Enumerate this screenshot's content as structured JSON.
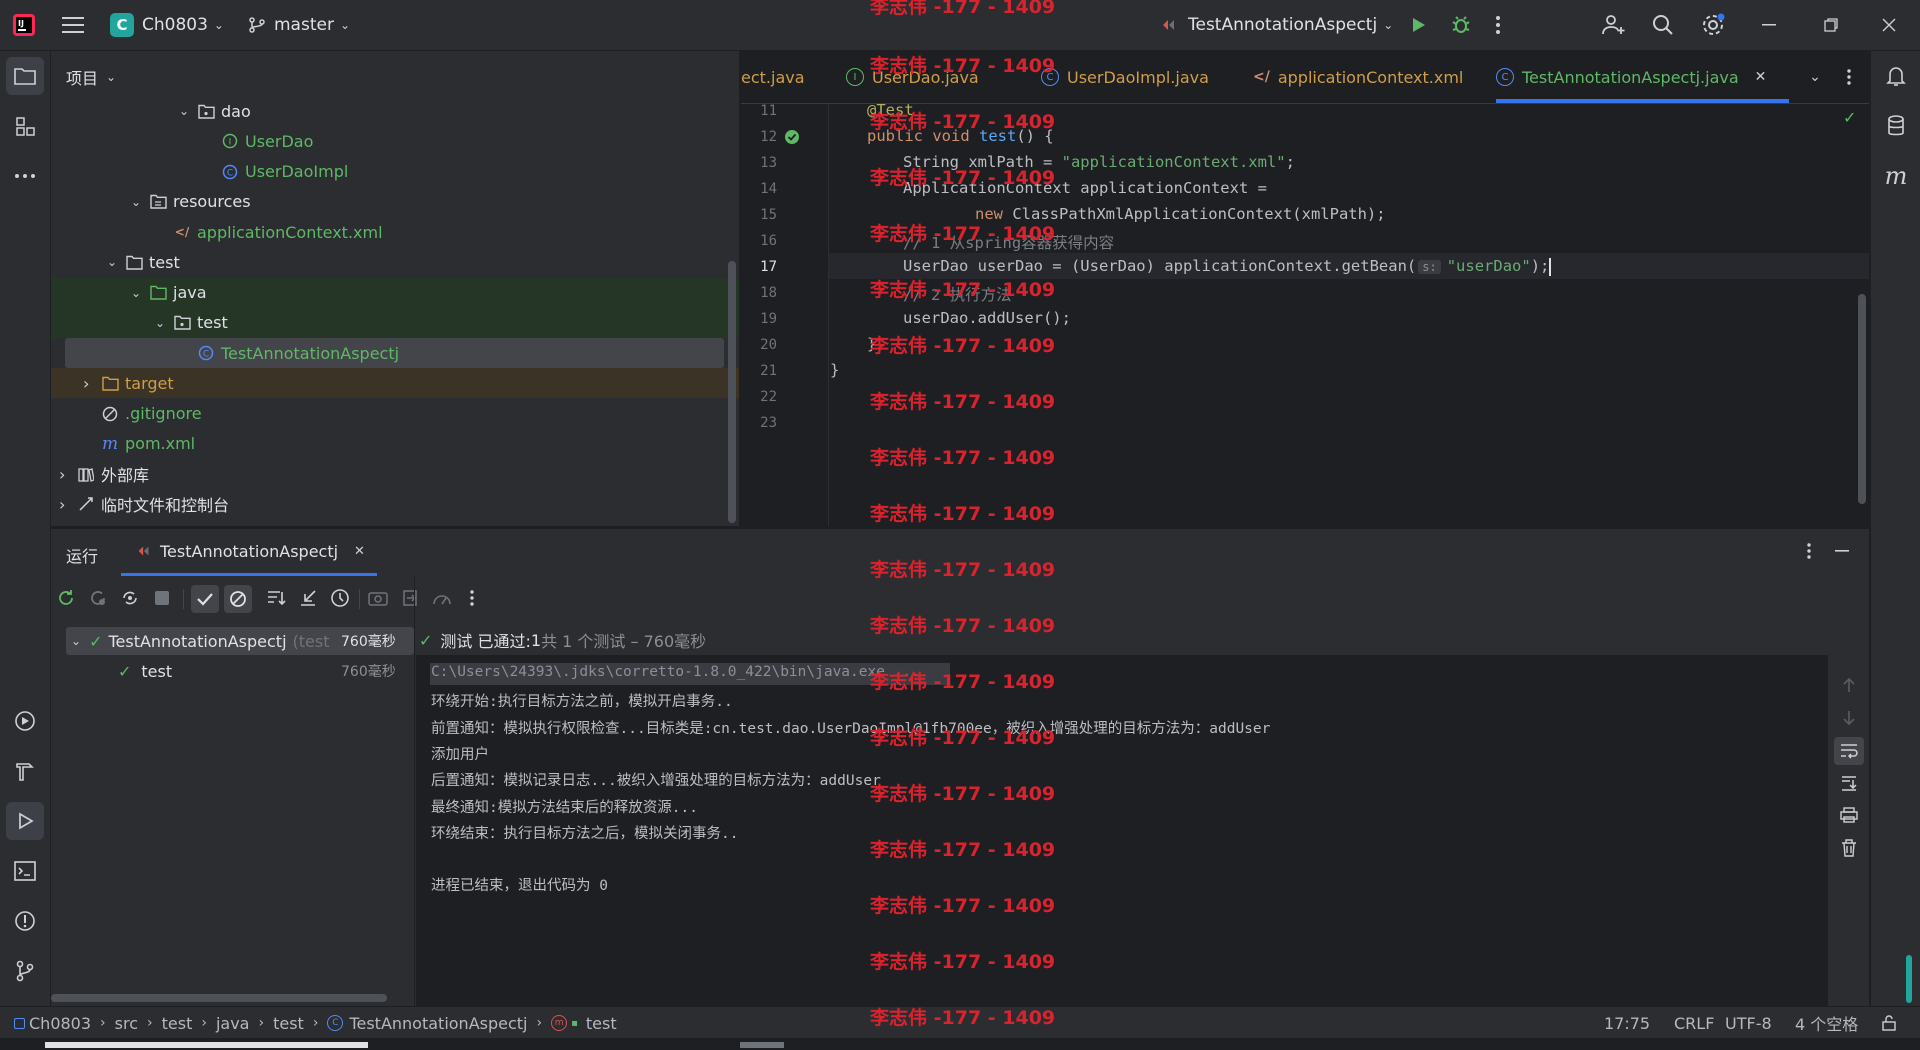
{
  "topbar": {
    "project_initial": "C",
    "project_name": "Ch0803",
    "branch": "master",
    "run_config": "TestAnnotationAspectj"
  },
  "project_panel": {
    "title": "项目",
    "tree": [
      {
        "label": "dao",
        "kind": "package",
        "depth": 5,
        "expanded": true
      },
      {
        "label": "UserDao",
        "kind": "interface",
        "depth": 6
      },
      {
        "label": "UserDaoImpl",
        "kind": "class",
        "depth": 6
      },
      {
        "label": "resources",
        "kind": "resources-folder",
        "depth": 3,
        "expanded": true
      },
      {
        "label": "applicationContext.xml",
        "kind": "xml",
        "depth": 4
      },
      {
        "label": "test",
        "kind": "folder",
        "depth": 2,
        "expanded": true
      },
      {
        "label": "java",
        "kind": "test-root",
        "depth": 3,
        "expanded": true
      },
      {
        "label": "test",
        "kind": "package",
        "depth": 4,
        "expanded": true
      },
      {
        "label": "TestAnnotationAspectj",
        "kind": "class",
        "depth": 5,
        "selected": true
      },
      {
        "label": "target",
        "kind": "excluded-folder",
        "depth": 1,
        "expanded": false
      },
      {
        "label": ".gitignore",
        "kind": "ignore",
        "depth": 1
      },
      {
        "label": "pom.xml",
        "kind": "maven",
        "depth": 1
      },
      {
        "label": "外部库",
        "kind": "library",
        "depth": 0,
        "expanded": false
      },
      {
        "label": "临时文件和控制台",
        "kind": "scratch",
        "depth": 0,
        "expanded": false
      }
    ]
  },
  "editor": {
    "tabs": [
      {
        "label": "ect.java",
        "icon": "java-file-icon"
      },
      {
        "label": "UserDao.java",
        "icon": "interface-icon"
      },
      {
        "label": "UserDaoImpl.java",
        "icon": "class-icon"
      },
      {
        "label": "applicationContext.xml",
        "icon": "xml-icon"
      },
      {
        "label": "TestAnnotationAspectj.java",
        "icon": "class-icon",
        "active": true
      }
    ],
    "line_numbers": [
      "11",
      "12",
      "13",
      "14",
      "15",
      "16",
      "17",
      "18",
      "19",
      "20",
      "21",
      "22",
      "23"
    ],
    "inlay_hint": "s:",
    "code": {
      "l11": "@Test",
      "l12_kw": "public void ",
      "l12_fn": "test",
      "l12_rest": "() {",
      "l13_a": "String xmlPath = ",
      "l13_str": "\"applicationContext.xml\"",
      "l13_b": ";",
      "l14": "ApplicationContext applicationContext =",
      "l15_kw": "new ",
      "l15_rest": "ClassPathXmlApplicationContext(xmlPath);",
      "l16": "// 1 从spring容器获得内容",
      "l17_a": "UserDao userDao = (UserDao) applicationContext.getBean(",
      "l17_str": "\"userDao\"",
      "l17_b": ");",
      "l18": "// 2 执行方法",
      "l19": "userDao.addUser();",
      "l20": "}",
      "l21": "}"
    }
  },
  "run_panel": {
    "title": "运行",
    "tab_label": "TestAnnotationAspectj",
    "status_prefix": "测试 已通过: ",
    "status_count": "1",
    "status_detail": "共 1 个测试 – 760毫秒",
    "tests": [
      {
        "name": "TestAnnotationAspectj",
        "suffix": "(test",
        "time": "760毫秒"
      },
      {
        "name": "test",
        "time": "760毫秒"
      }
    ],
    "console": [
      "C:\\Users\\24393\\.jdks\\corretto-1.8.0_422\\bin\\java.exe ...",
      "环绕开始:执行目标方法之前，模拟开启事务..",
      "前置通知：模拟执行权限检查...目标类是:cn.test.dao.UserDaoImpl@1fb700ee，被织入增强处理的目标方法为：addUser",
      "添加用户",
      "后置通知：模拟记录日志...被织入增强处理的目标方法为：addUser",
      "最终通知:模拟方法结束后的释放资源...",
      "环绕结束：执行目标方法之后，模拟关闭事务..",
      "",
      "进程已结束，退出代码为 0"
    ]
  },
  "statusbar": {
    "breadcrumbs": [
      "Ch0803",
      "src",
      "test",
      "java",
      "test",
      "TestAnnotationAspectj",
      "test"
    ],
    "position": "17:75",
    "line_ending": "CRLF",
    "encoding": "UTF-8",
    "indent": "4 个空格"
  },
  "watermark": "李志伟 -177 - 1409",
  "colors": {
    "accent": "#3574f0",
    "pass_green": "#5fb865",
    "error_red": "#d9232e",
    "string_green": "#6aab73",
    "keyword_orange": "#cf8e6d"
  }
}
